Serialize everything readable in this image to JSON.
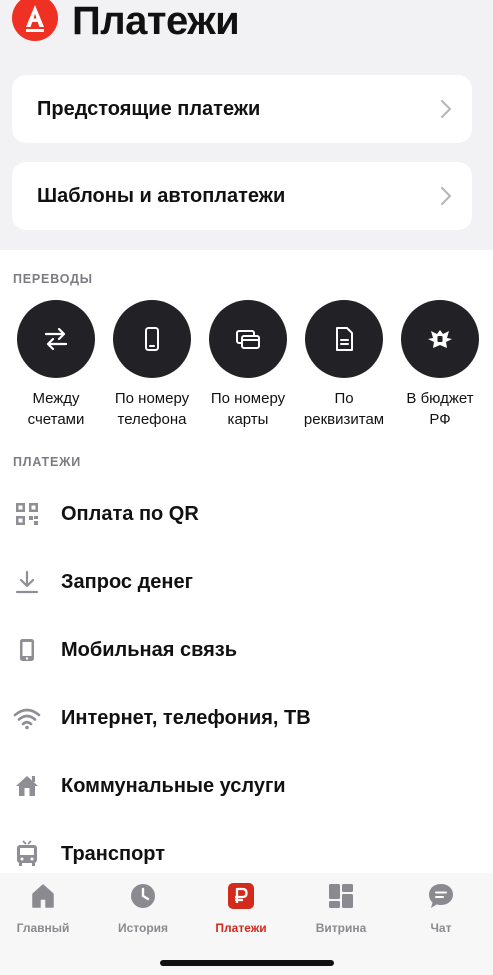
{
  "header": {
    "title": "Платежи",
    "logo_letter": "А"
  },
  "cards": [
    {
      "label": "Предстоящие платежи"
    },
    {
      "label": "Шаблоны и автоплатежи"
    }
  ],
  "transfers": {
    "title": "ПЕРЕВОДЫ",
    "items": [
      {
        "line1": "Между",
        "line2": "счетами",
        "icon": "arrows-swap-icon"
      },
      {
        "line1": "По номеру",
        "line2": "телефона",
        "icon": "phone-icon"
      },
      {
        "line1": "По номеру",
        "line2": "карты",
        "icon": "cards-icon"
      },
      {
        "line1": "По",
        "line2": "реквизитам",
        "icon": "document-icon"
      },
      {
        "line1": "В бюджет",
        "line2": "РФ",
        "icon": "emblem-icon"
      }
    ]
  },
  "payments": {
    "title": "ПЛАТЕЖИ",
    "items": [
      {
        "label": "Оплата по QR",
        "icon": "qr-icon"
      },
      {
        "label": "Запрос денег",
        "icon": "download-icon"
      },
      {
        "label": "Мобильная связь",
        "icon": "mobile-icon"
      },
      {
        "label": "Интернет, телефония, ТВ",
        "icon": "wifi-icon"
      },
      {
        "label": "Коммунальные услуги",
        "icon": "house-icon"
      },
      {
        "label": "Транспорт",
        "icon": "bus-icon"
      }
    ]
  },
  "tabbar": {
    "items": [
      {
        "label": "Главный",
        "icon": "home-icon"
      },
      {
        "label": "История",
        "icon": "clock-icon"
      },
      {
        "label": "Платежи",
        "icon": "ruble-icon",
        "active": true
      },
      {
        "label": "Витрина",
        "icon": "showcase-icon"
      },
      {
        "label": "Чат",
        "icon": "chat-icon"
      }
    ]
  },
  "colors": {
    "accent": "#ef3124",
    "active_tab": "#d42a1c",
    "dark_circle": "#222226"
  }
}
